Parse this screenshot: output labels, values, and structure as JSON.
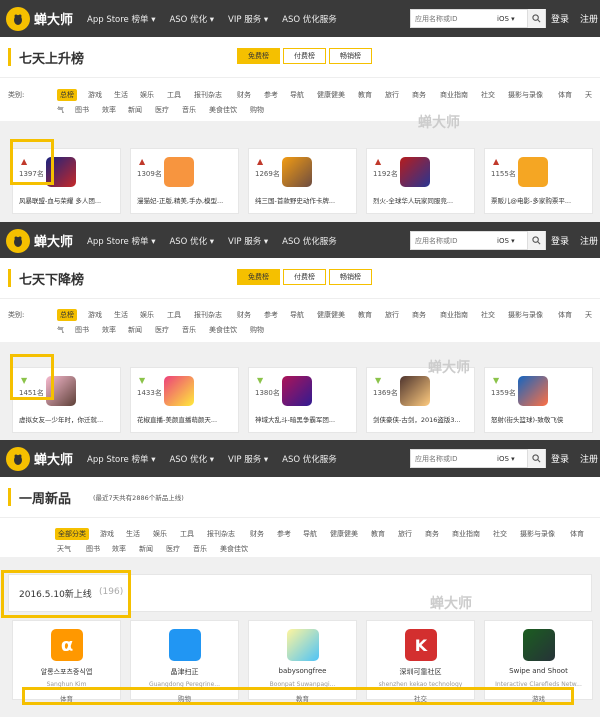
{
  "nav": {
    "logo_text": "蝉大师",
    "items": [
      "App Store 榜单 ▾",
      "ASO 优化 ▾",
      "VIP 服务 ▾",
      "ASO 优化服务"
    ],
    "search_placeholder": "应用名称或ID",
    "search_ios": "iOS ▾",
    "login": "登录",
    "register": "注册"
  },
  "sections": {
    "rise": {
      "title": "七天上升榜"
    },
    "fall": {
      "title": "七天下降榜"
    },
    "new": {
      "title": "一周新品",
      "note": "(最近7天共有2886个新品上线)"
    }
  },
  "tabs": [
    "免费榜",
    "付费榜",
    "畅销榜"
  ],
  "category_label": "类别:",
  "categories_row1": [
    "总榜",
    "游戏",
    "生活",
    "娱乐",
    "工具",
    "报刊杂志",
    "财务",
    "参考",
    "导航",
    "健康健美",
    "教育",
    "旅行",
    "商务",
    "商业指南",
    "社交",
    "摄影与录像",
    "体育",
    "天"
  ],
  "categories_row2": [
    "气",
    "图书",
    "效率",
    "新闻",
    "医疗",
    "音乐",
    "美食佳饮",
    "购物"
  ],
  "new_categories_row1": [
    "全部分类",
    "游戏",
    "生活",
    "娱乐",
    "工具",
    "报刊杂志",
    "财务",
    "参考",
    "导航",
    "健康健美",
    "教育",
    "旅行",
    "商务",
    "商业指南",
    "社交",
    "摄影与录像",
    "体育"
  ],
  "new_categories_row2": [
    "天气",
    "图书",
    "效率",
    "新闻",
    "医疗",
    "音乐",
    "美食佳饮"
  ],
  "rise_cards": [
    {
      "rank": "1397名",
      "name": "风暴联盟-血与荣耀 多人团..."
    },
    {
      "rank": "1309名",
      "name": "漫猫妃-正版,精美,手办,模型..."
    },
    {
      "rank": "1269名",
      "name": "纯三国-首款野史动作卡牌..."
    },
    {
      "rank": "1192名",
      "name": "烈火-全球华人玩家同服竞..."
    },
    {
      "rank": "1155名",
      "name": "票贩儿@电影-多家购票平..."
    }
  ],
  "fall_cards": [
    {
      "rank": "1451名",
      "name": "虚拟女友—少年时，你迁就..."
    },
    {
      "rank": "1433名",
      "name": "花椒直播-美颜直播萌颜天..."
    },
    {
      "rank": "1380名",
      "name": "神域大乱斗-暗黑争霸军团..."
    },
    {
      "rank": "1369名",
      "name": "剑侠豪侠-古剑，2016盗版3..."
    },
    {
      "rank": "1359名",
      "name": "怒射(街头篮球)-致敬飞侠"
    }
  ],
  "new_date": "2016.5.10新上线",
  "new_count": "(196)",
  "new_cards": [
    {
      "name": "알롱스포츠중식앱",
      "dev": "Sanghun Kim",
      "cat": "体育"
    },
    {
      "name": "晶津扫正",
      "dev": "Guangdong Peregrine...",
      "cat": "购物"
    },
    {
      "name": "babysongfree",
      "dev": "Boonpat Suwanpagi...",
      "cat": "教育"
    },
    {
      "name": "深圳可靠社区",
      "dev": "shenzhen kekao technology",
      "cat": "社交"
    },
    {
      "name": "Swipe and Shoot",
      "dev": "Interactive Clarefieds Netw...",
      "cat": "游戏"
    }
  ],
  "watermark": "蝉大师",
  "colors": {
    "accent": "#f5c000",
    "nav_bg": "#3a3a3a",
    "up": "#c0392b",
    "down": "#8bc34a"
  }
}
